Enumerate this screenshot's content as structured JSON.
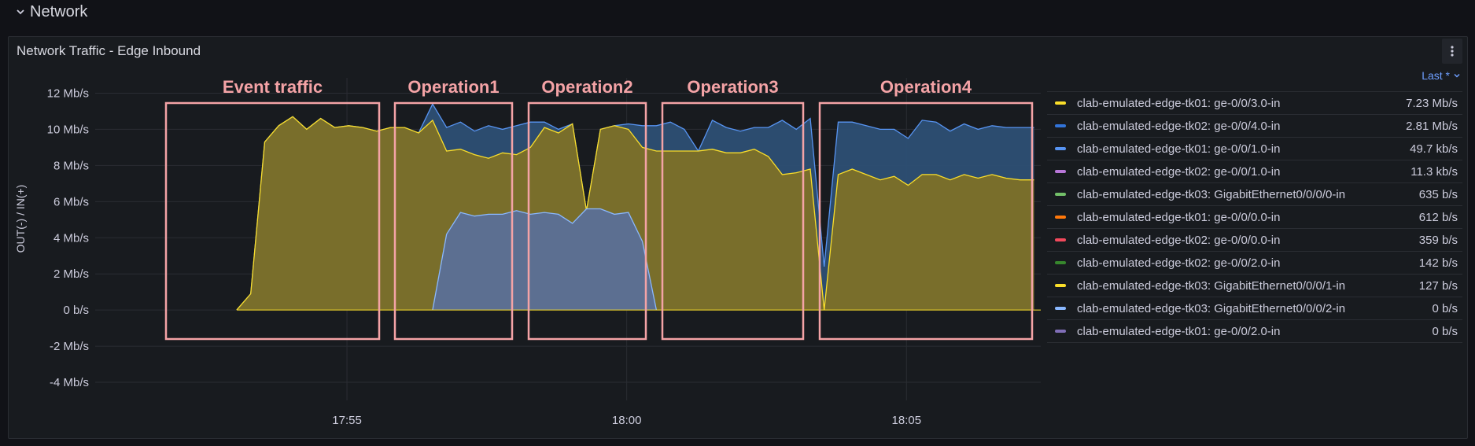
{
  "row": {
    "title": "Network",
    "icon": "chevron-down-icon"
  },
  "panel": {
    "title": "Network Traffic - Edge Inbound",
    "menu_icon": "kebab-menu-icon"
  },
  "annotations": [
    "Event traffic",
    "Operation1",
    "Operation2",
    "Operation3",
    "Operation4"
  ],
  "colors": {
    "annotation": "#f4a3a6",
    "yellow": "#fade2a",
    "yellow_fill": "#807125",
    "blue": "#5794f2",
    "blue_fill": "#2d4f74",
    "lightblue": "#8ab8ff",
    "lightblue_fill": "#5a6f9a",
    "grid": "#2a2d33"
  },
  "legend": {
    "sort_label": "Last *",
    "items": [
      {
        "name": "clab-emulated-edge-tk01: ge-0/0/3.0-in",
        "value": "7.23 Mb/s",
        "color": "#fade2a"
      },
      {
        "name": "clab-emulated-edge-tk02: ge-0/0/4.0-in",
        "value": "2.81 Mb/s",
        "color": "#3274d9"
      },
      {
        "name": "clab-emulated-edge-tk01: ge-0/0/1.0-in",
        "value": "49.7 kb/s",
        "color": "#5794f2"
      },
      {
        "name": "clab-emulated-edge-tk02: ge-0/0/1.0-in",
        "value": "11.3 kb/s",
        "color": "#b877d9"
      },
      {
        "name": "clab-emulated-edge-tk03: GigabitEthernet0/0/0/0-in",
        "value": "635 b/s",
        "color": "#73bf69"
      },
      {
        "name": "clab-emulated-edge-tk01: ge-0/0/0.0-in",
        "value": "612 b/s",
        "color": "#ff780a"
      },
      {
        "name": "clab-emulated-edge-tk02: ge-0/0/0.0-in",
        "value": "359 b/s",
        "color": "#f2495c"
      },
      {
        "name": "clab-emulated-edge-tk02: ge-0/0/2.0-in",
        "value": "142 b/s",
        "color": "#37872d"
      },
      {
        "name": "clab-emulated-edge-tk03: GigabitEthernet0/0/0/1-in",
        "value": "127 b/s",
        "color": "#fade2a"
      },
      {
        "name": "clab-emulated-edge-tk03: GigabitEthernet0/0/0/2-in",
        "value": "0 b/s",
        "color": "#8ab8ff"
      },
      {
        "name": "clab-emulated-edge-tk01: ge-0/0/2.0-in",
        "value": "0 b/s",
        "color": "#806eb7"
      }
    ]
  },
  "chart_data": {
    "type": "area",
    "ylabel": "OUT(-) / IN(+)",
    "unit": "Mb/s",
    "ylim": [
      -5,
      12.5
    ],
    "y_ticks": [
      {
        "value": 12,
        "label": "12 Mb/s"
      },
      {
        "value": 10,
        "label": "10 Mb/s"
      },
      {
        "value": 8,
        "label": "8 Mb/s"
      },
      {
        "value": 6,
        "label": "6 Mb/s"
      },
      {
        "value": 4,
        "label": "4 Mb/s"
      },
      {
        "value": 2,
        "label": "2 Mb/s"
      },
      {
        "value": 0,
        "label": "0 b/s"
      },
      {
        "value": -2,
        "label": "-2 Mb/s"
      },
      {
        "value": -4,
        "label": "-4 Mb/s"
      }
    ],
    "x_range_minutes": [
      50.5,
      67.4
    ],
    "x_ticks": [
      {
        "minute": 55,
        "label": "17:55"
      },
      {
        "minute": 60,
        "label": "18:00"
      },
      {
        "minute": 65,
        "label": "18:05"
      }
    ],
    "grid": true,
    "legend_position": "right",
    "series": [
      {
        "name": "clab-emulated-edge-tk01: ge-0/0/3.0-in",
        "color": "#fade2a",
        "x": [
          53.03,
          53.28,
          53.53,
          53.78,
          54.03,
          54.28,
          54.53,
          54.78,
          55.03,
          55.28,
          55.53,
          55.78,
          56.03,
          56.28,
          56.53,
          56.78,
          57.03,
          57.28,
          57.53,
          57.78,
          58.03,
          58.28,
          58.53,
          58.78,
          59.03,
          59.28,
          59.53,
          59.78,
          60.03,
          60.28,
          60.53,
          60.78,
          61.03,
          61.28,
          61.53,
          61.78,
          62.03,
          62.28,
          62.53,
          62.78,
          63.03,
          63.28,
          63.53,
          63.78,
          64.03,
          64.28,
          64.53,
          64.78,
          65.03,
          65.28,
          65.53,
          65.78,
          66.03,
          66.28,
          66.53,
          66.78,
          67.03,
          67.28
        ],
        "values": [
          0,
          0.9,
          9.3,
          10.2,
          10.7,
          10.0,
          10.6,
          10.1,
          10.2,
          10.1,
          9.9,
          10.1,
          10.1,
          9.8,
          10.5,
          8.8,
          8.9,
          8.6,
          8.4,
          8.7,
          8.6,
          9.0,
          10.1,
          9.8,
          10.3,
          5.5,
          10.0,
          10.2,
          10.0,
          9.0,
          8.8,
          8.8,
          8.8,
          8.8,
          8.9,
          8.7,
          8.7,
          8.9,
          8.5,
          7.5,
          7.6,
          7.8,
          0,
          7.5,
          7.8,
          7.5,
          7.2,
          7.4,
          6.9,
          7.5,
          7.5,
          7.2,
          7.5,
          7.3,
          7.5,
          7.3,
          7.2,
          7.2
        ]
      },
      {
        "name": "clab-emulated-edge-tk02: ge-0/0/4.0-in",
        "color": "#3274d9",
        "x": [
          53.03,
          53.28,
          53.53,
          53.78,
          54.03,
          54.28,
          54.53,
          54.78,
          55.03,
          55.28,
          55.53,
          55.78,
          56.03,
          56.28,
          56.53,
          56.78,
          57.03,
          57.28,
          57.53,
          57.78,
          58.03,
          58.28,
          58.53,
          58.78,
          59.03,
          59.28,
          59.53,
          59.78,
          60.03,
          60.28,
          60.53,
          60.78,
          61.03,
          61.28,
          61.53,
          61.78,
          62.03,
          62.28,
          62.53,
          62.78,
          63.03,
          63.28,
          63.53,
          63.78,
          64.03,
          64.28,
          64.53,
          64.78,
          65.03,
          65.28,
          65.53,
          65.78,
          66.03,
          66.28,
          66.53,
          66.78,
          67.03,
          67.28
        ],
        "values": [
          0,
          0.9,
          9.3,
          10.2,
          10.7,
          10.0,
          10.6,
          10.1,
          10.2,
          10.1,
          9.9,
          10.1,
          10.1,
          9.8,
          11.4,
          10.1,
          10.4,
          9.9,
          10.2,
          10.0,
          10.2,
          10.4,
          10.4,
          10.0,
          10.3,
          5.5,
          10.0,
          10.2,
          10.3,
          10.2,
          10.2,
          10.4,
          10.0,
          8.8,
          10.5,
          10.1,
          9.9,
          10.1,
          10.1,
          10.5,
          10.0,
          10.6,
          2.4,
          10.4,
          10.4,
          10.2,
          10.0,
          10.0,
          9.5,
          10.5,
          10.4,
          9.9,
          10.3,
          10.0,
          10.2,
          10.1,
          10.1,
          10.1
        ]
      },
      {
        "name": "clab-emulated-edge-tk01: ge-0/0/1.0-in",
        "color": "#8ab8ff",
        "x": [
          56.53,
          56.78,
          57.03,
          57.28,
          57.53,
          57.78,
          58.03,
          58.28,
          58.53,
          58.78,
          59.03,
          59.28,
          59.53,
          59.78,
          60.03,
          60.28,
          60.53
        ],
        "values": [
          0,
          4.2,
          5.4,
          5.2,
          5.3,
          5.3,
          5.5,
          5.3,
          5.4,
          5.3,
          4.8,
          5.6,
          5.6,
          5.3,
          5.4,
          3.8,
          0
        ]
      }
    ]
  }
}
